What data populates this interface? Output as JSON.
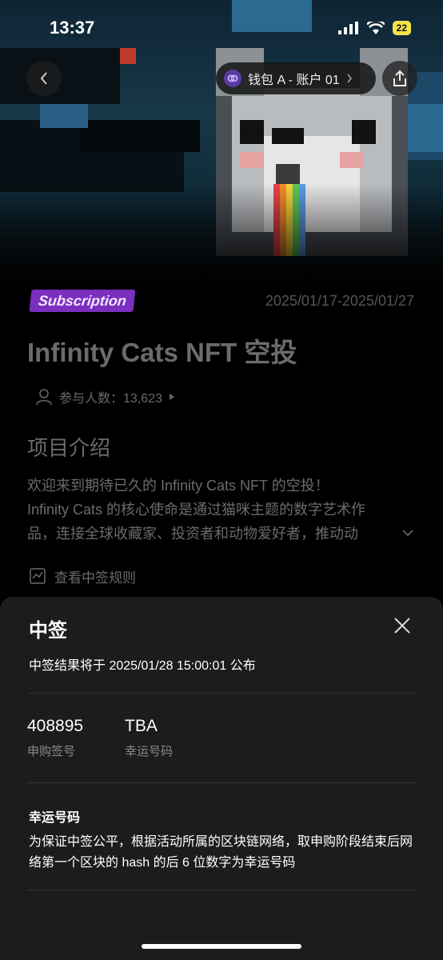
{
  "status_bar": {
    "time": "13:37",
    "battery": "22"
  },
  "header": {
    "wallet_label": "钱包 A - 账户 01"
  },
  "project": {
    "badge": "Subscription",
    "date_range": "2025/01/17-2025/01/27",
    "title": "Infinity Cats NFT 空投",
    "participants": "参与人数：13,623"
  },
  "intro": {
    "title": "项目介绍",
    "lines": [
      "欢迎来到期待已久的 Infinity Cats NFT 的空投！",
      "Infinity Cats 的核心使命是通过猫咪主题的数字艺术作",
      "品，连接全球收藏家、投资者和动物爱好者，推动动"
    ],
    "rules_link": "查看中签规则"
  },
  "sheet": {
    "title": "中签",
    "announce": "中签结果将于 2025/01/28 15:00:01 公布",
    "numbers": [
      {
        "value": "408895",
        "label": "申购签号"
      },
      {
        "value": "TBA",
        "label": "幸运号码"
      }
    ],
    "lucky_title": "幸运号码",
    "lucky_text": "为保证中签公平，根据活动所属的区块链网络，取申购阶段结束后网络第一个区块的 hash 的后 6 位数字为幸运号码"
  },
  "colors": {
    "badge": "#7b2fbe",
    "sheet_bg": "#1c1c1e",
    "battery": "#f2e34b"
  }
}
